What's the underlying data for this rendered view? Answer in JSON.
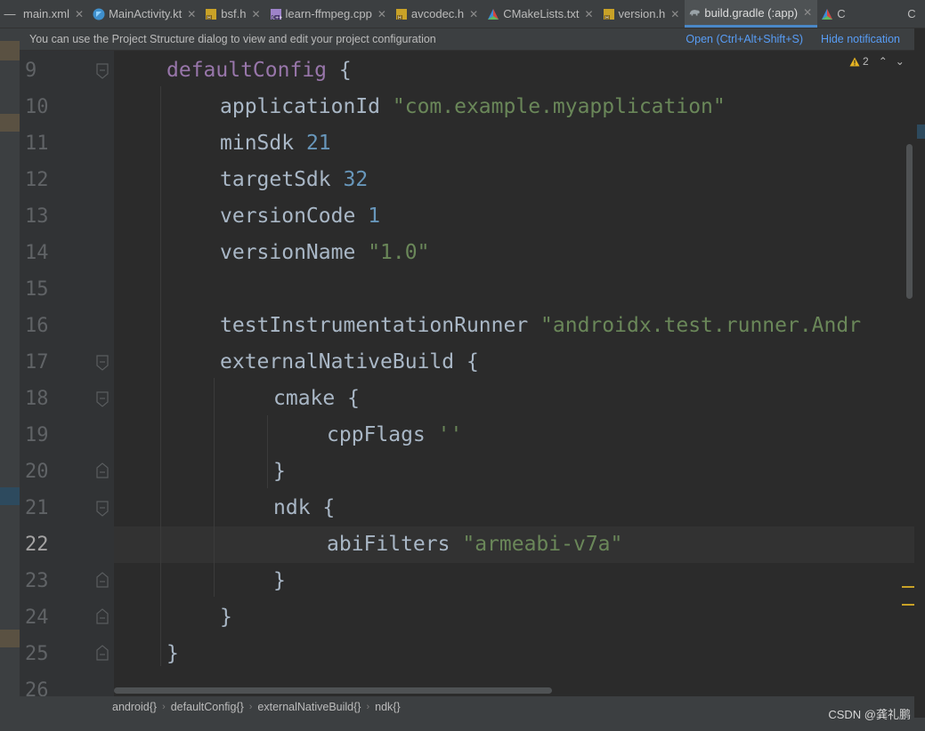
{
  "tabs": [
    {
      "label": "main.xml",
      "icon": "xml-file-icon",
      "active": false
    },
    {
      "label": "MainActivity.kt",
      "icon": "kotlin-file-icon",
      "active": false
    },
    {
      "label": "bsf.h",
      "icon": "header-file-icon",
      "active": false
    },
    {
      "label": "learn-ffmpeg.cpp",
      "icon": "cpp-file-icon",
      "active": false
    },
    {
      "label": "avcodec.h",
      "icon": "header-file-icon",
      "active": false
    },
    {
      "label": "CMakeLists.txt",
      "icon": "cmake-file-icon",
      "active": false
    },
    {
      "label": "version.h",
      "icon": "header-file-icon",
      "active": false
    },
    {
      "label": "build.gradle (:app)",
      "icon": "gradle-file-icon",
      "active": true
    },
    {
      "label": "C",
      "icon": "cmake-file-icon",
      "active": false
    }
  ],
  "tab_overflow_label": "C",
  "notification": {
    "message": "You can use the Project Structure dialog to view and edit your project configuration",
    "open_link": "Open (Ctrl+Alt+Shift+S)",
    "hide_link": "Hide notification"
  },
  "inspection": {
    "warning_count": "2"
  },
  "editor": {
    "current_line": "22",
    "line_numbers": [
      "9",
      "10",
      "11",
      "12",
      "13",
      "14",
      "15",
      "16",
      "17",
      "18",
      "19",
      "20",
      "21",
      "22",
      "23",
      "24",
      "25",
      "26"
    ],
    "code": {
      "l9": {
        "kw": "defaultConfig",
        "punct": " {"
      },
      "l10": {
        "id": "applicationId",
        "str": "\"com.example.myapplication\""
      },
      "l11": {
        "id": "minSdk",
        "num": "21"
      },
      "l12": {
        "id": "targetSdk",
        "num": "32"
      },
      "l13": {
        "id": "versionCode",
        "num": "1"
      },
      "l14": {
        "id": "versionName",
        "str": "\"1.0\""
      },
      "l16": {
        "id": "testInstrumentationRunner",
        "str": "\"androidx.test.runner.Andr"
      },
      "l17": {
        "id": "externalNativeBuild",
        "punct": " {"
      },
      "l18": {
        "id": "cmake",
        "punct": " {"
      },
      "l19": {
        "id": "cppFlags",
        "str": "''"
      },
      "l20": {
        "punct": "}"
      },
      "l21": {
        "id": "ndk",
        "punct": " {"
      },
      "l22": {
        "id": "abiFilters",
        "str": "\"armeabi-v7a\""
      },
      "l23": {
        "punct": "}"
      },
      "l24": {
        "punct": "}"
      },
      "l25": {
        "punct": "}"
      }
    }
  },
  "breadcrumb": [
    "android{}",
    "defaultConfig{}",
    "externalNativeBuild{}",
    "ndk{}"
  ],
  "watermark": "CSDN @龚礼鹏",
  "colors": {
    "keyword": "#9876aa",
    "identifier": "#a9b7c6",
    "string": "#6a8759",
    "number": "#6897bb",
    "link": "#589df6",
    "warning": "#e6b422",
    "active_tab_underline": "#4a88c7"
  }
}
